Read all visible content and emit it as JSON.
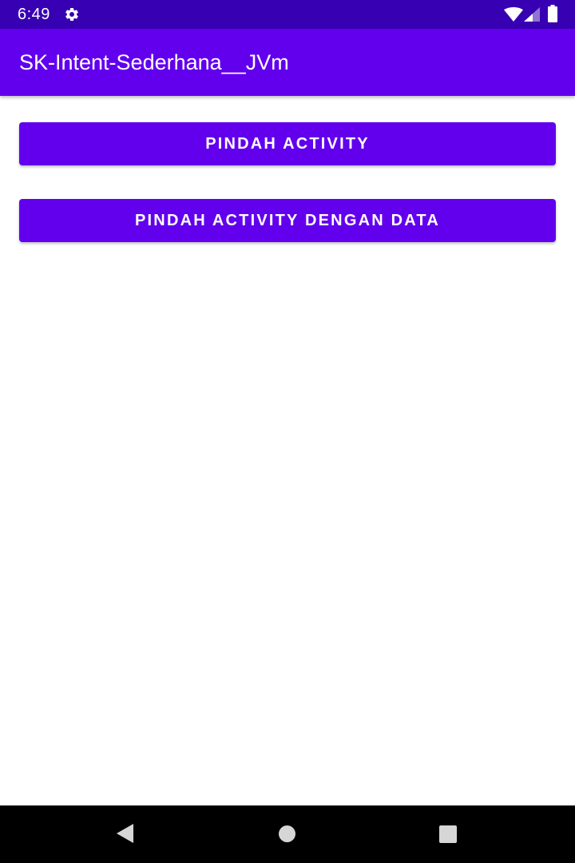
{
  "status_bar": {
    "time": "6:49",
    "icons": [
      "gear-icon",
      "wifi-icon",
      "signal-icon",
      "battery-icon"
    ],
    "background": "#3700b3"
  },
  "app_bar": {
    "title": "SK-Intent-Sederhana__JVm",
    "background": "#6200ee"
  },
  "buttons": [
    {
      "label": "PINDAH ACTIVITY"
    },
    {
      "label": "PINDAH ACTIVITY DENGAN DATA"
    }
  ],
  "colors": {
    "primary": "#6200ee",
    "primary_dark": "#3700b3",
    "on_primary": "#ffffff"
  },
  "nav_bar": {
    "icons": [
      "back-icon",
      "home-icon",
      "recents-icon"
    ]
  }
}
